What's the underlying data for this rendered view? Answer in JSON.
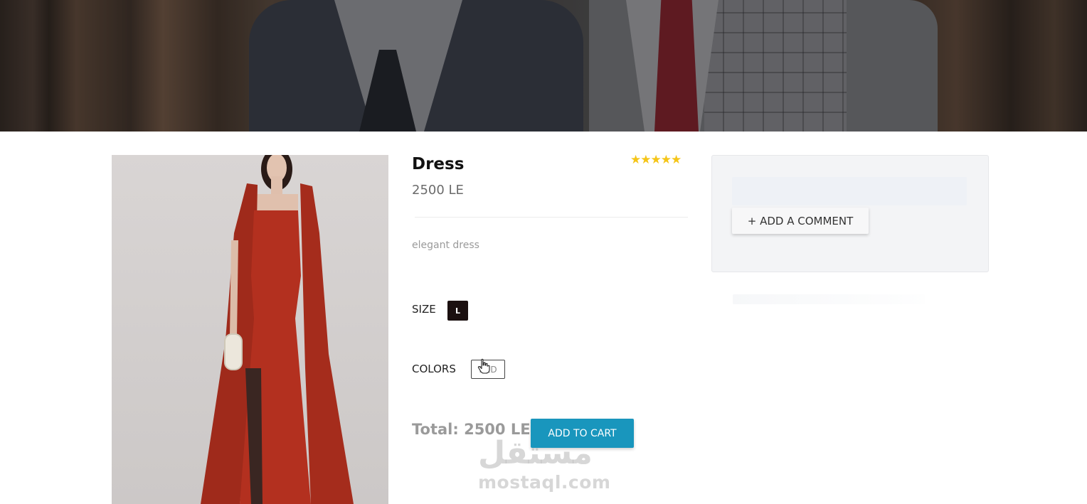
{
  "product": {
    "title": "Dress",
    "rating_stars": "★★★★★",
    "price": "2500 LE",
    "description": "elegant dress",
    "size_label": "SIZE",
    "size_value": "L",
    "colors_label": "COLORS",
    "color_value": "RED",
    "total": "Total: 2500 LE",
    "add_to_cart_label": "ADD TO CART"
  },
  "comments": {
    "add_comment_label": "+ ADD A COMMENT",
    "input_value": ""
  },
  "watermark": {
    "logo": "مستقل",
    "text": "mostaql.com"
  },
  "colors": {
    "accent": "#1996bd",
    "stars": "#f5c518",
    "size_chip": "#1b1010",
    "dress": "#b3301f"
  }
}
